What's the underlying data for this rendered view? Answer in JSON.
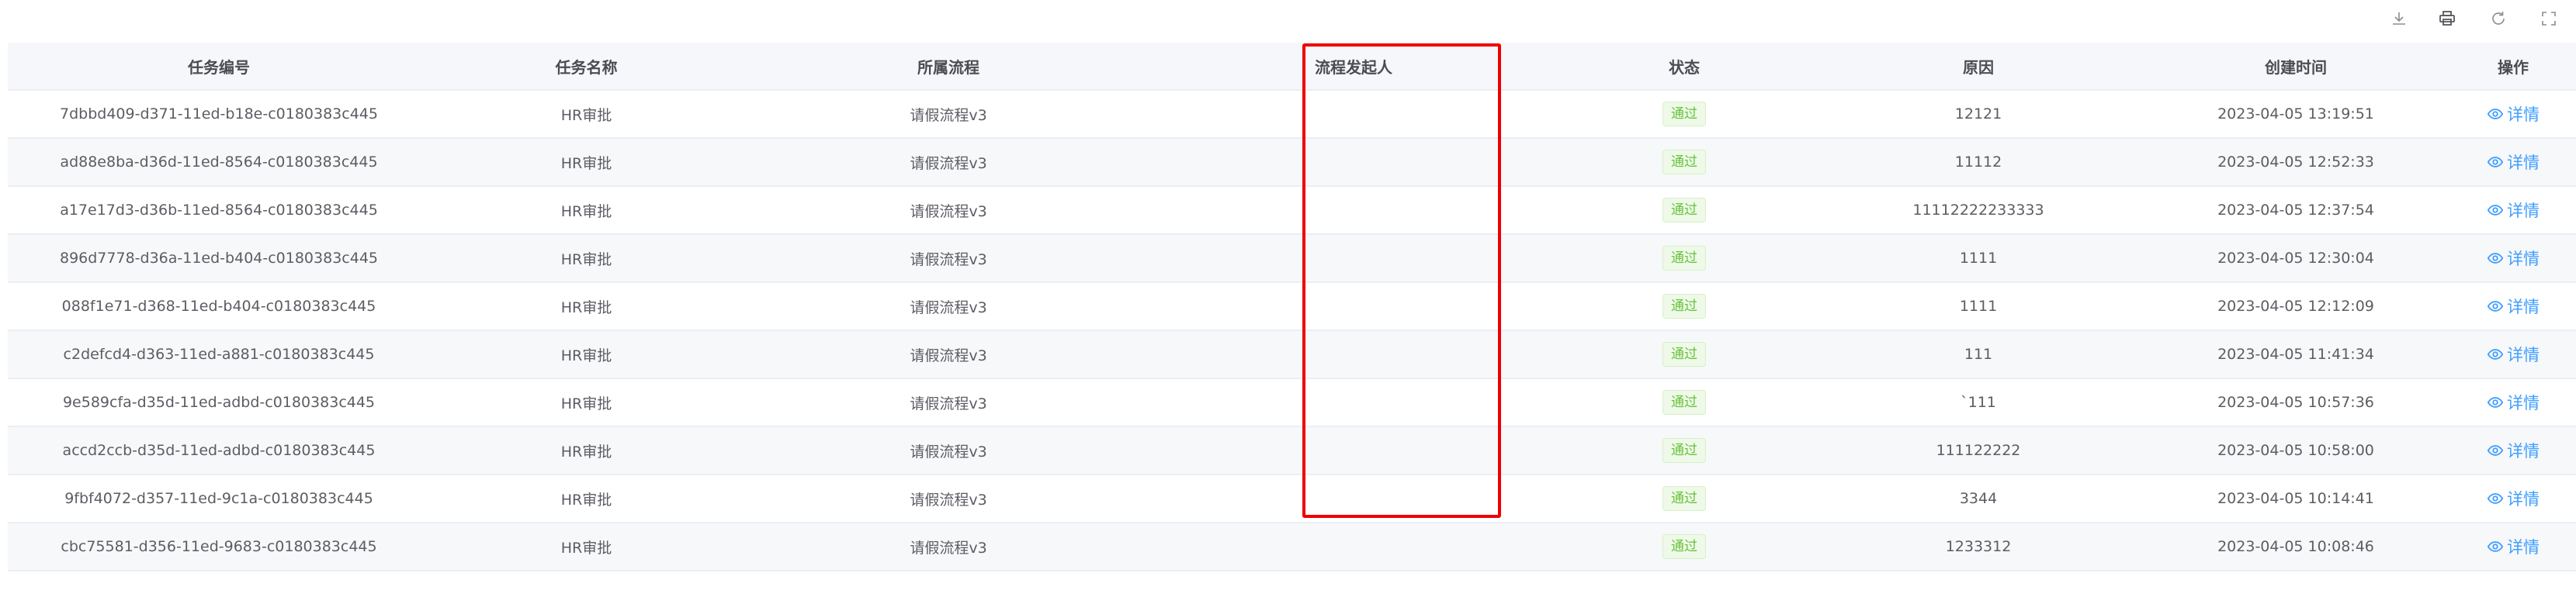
{
  "toolbar": {
    "icons": [
      "download-icon",
      "print-icon",
      "refresh-icon",
      "fullscreen-icon"
    ]
  },
  "table": {
    "columns": [
      "任务编号",
      "任务名称",
      "所属流程",
      "流程发起人",
      "状态",
      "原因",
      "创建时间",
      "操作"
    ],
    "status_label": "通过",
    "action_label": "详情",
    "rows": [
      {
        "id": "7dbbd409-d371-11ed-b18e-c0180383c445",
        "name": "HR审批",
        "process": "请假流程v3",
        "initiator": "",
        "reason": "12121",
        "created": "2023-04-05 13:19:51"
      },
      {
        "id": "ad88e8ba-d36d-11ed-8564-c0180383c445",
        "name": "HR审批",
        "process": "请假流程v3",
        "initiator": "",
        "reason": "11112",
        "created": "2023-04-05 12:52:33"
      },
      {
        "id": "a17e17d3-d36b-11ed-8564-c0180383c445",
        "name": "HR审批",
        "process": "请假流程v3",
        "initiator": "",
        "reason": "11112222233333",
        "created": "2023-04-05 12:37:54"
      },
      {
        "id": "896d7778-d36a-11ed-b404-c0180383c445",
        "name": "HR审批",
        "process": "请假流程v3",
        "initiator": "",
        "reason": "1111",
        "created": "2023-04-05 12:30:04"
      },
      {
        "id": "088f1e71-d368-11ed-b404-c0180383c445",
        "name": "HR审批",
        "process": "请假流程v3",
        "initiator": "",
        "reason": "1111",
        "created": "2023-04-05 12:12:09"
      },
      {
        "id": "c2defcd4-d363-11ed-a881-c0180383c445",
        "name": "HR审批",
        "process": "请假流程v3",
        "initiator": "",
        "reason": "111",
        "created": "2023-04-05 11:41:34"
      },
      {
        "id": "9e589cfa-d35d-11ed-adbd-c0180383c445",
        "name": "HR审批",
        "process": "请假流程v3",
        "initiator": "",
        "reason": "`111",
        "created": "2023-04-05 10:57:36"
      },
      {
        "id": "accd2ccb-d35d-11ed-adbd-c0180383c445",
        "name": "HR审批",
        "process": "请假流程v3",
        "initiator": "",
        "reason": "111122222",
        "created": "2023-04-05 10:58:00"
      },
      {
        "id": "9fbf4072-d357-11ed-9c1a-c0180383c445",
        "name": "HR审批",
        "process": "请假流程v3",
        "initiator": "",
        "reason": "3344",
        "created": "2023-04-05 10:14:41"
      },
      {
        "id": "cbc75581-d356-11ed-9683-c0180383c445",
        "name": "HR审批",
        "process": "请假流程v3",
        "initiator": "",
        "reason": "1233312",
        "created": "2023-04-05 10:08:46"
      }
    ]
  },
  "colors": {
    "highlight": "#f00000",
    "status_green": "#67c23a",
    "link_blue": "#409eff"
  }
}
